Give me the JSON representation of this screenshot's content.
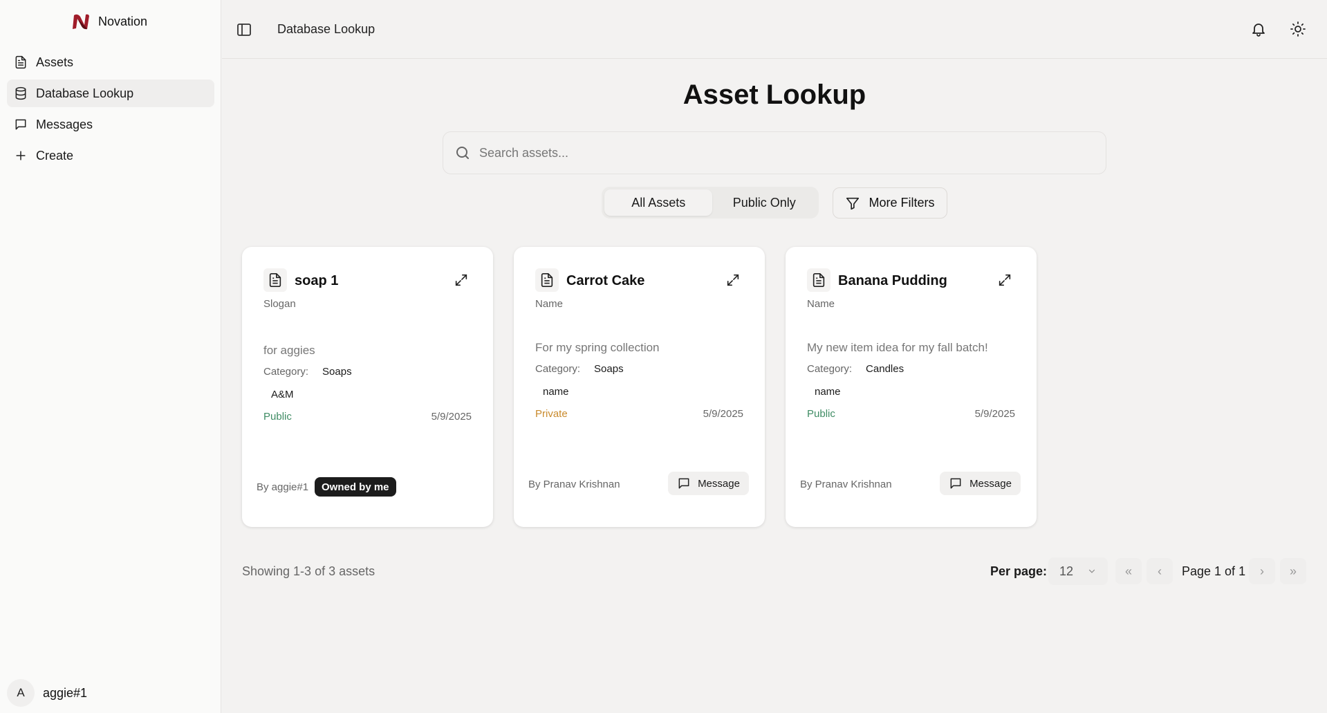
{
  "brand": {
    "name": "Novation",
    "accent": "#a01c2a"
  },
  "sidebar": {
    "items": [
      {
        "label": "Assets",
        "icon": "document-icon"
      },
      {
        "label": "Database Lookup",
        "icon": "database-icon"
      },
      {
        "label": "Messages",
        "icon": "message-icon"
      },
      {
        "label": "Create",
        "icon": "plus-icon"
      }
    ],
    "active": "Database Lookup"
  },
  "user": {
    "initial": "A",
    "name": "aggie#1"
  },
  "header": {
    "title": "Database Lookup"
  },
  "main": {
    "title": "Asset Lookup",
    "search_placeholder": "Search assets...",
    "filters": {
      "all_label": "All Assets",
      "public_label": "Public Only",
      "more_label": "More Filters",
      "selected": "All Assets"
    }
  },
  "cards": [
    {
      "title": "soap 1",
      "type": "Slogan",
      "description": "for aggies",
      "category_label": "Category:",
      "category": "Soaps",
      "tag": "A&M",
      "visibility": "Public",
      "date": "5/9/2025",
      "owner": "By aggie#1",
      "badge": "Owned by me"
    },
    {
      "title": "Carrot Cake",
      "type": "Name",
      "description": "For my spring collection",
      "category_label": "Category:",
      "category": "Soaps",
      "tag": "name",
      "visibility": "Private",
      "date": "5/9/2025",
      "owner": "By Pranav Krishnan",
      "action": "Message"
    },
    {
      "title": "Banana Pudding",
      "type": "Name",
      "description": "My new item idea for my fall batch!",
      "category_label": "Category:",
      "category": "Candles",
      "tag": "name",
      "visibility": "Public",
      "date": "5/9/2025",
      "owner": "By Pranav Krishnan",
      "action": "Message"
    }
  ],
  "pagination": {
    "showing": "Showing 1-3 of 3 assets",
    "per_page_label": "Per page:",
    "per_page_value": "12",
    "first": "«",
    "prev": "‹",
    "next": "›",
    "last": "»",
    "page_label": "Page 1 of 1"
  }
}
